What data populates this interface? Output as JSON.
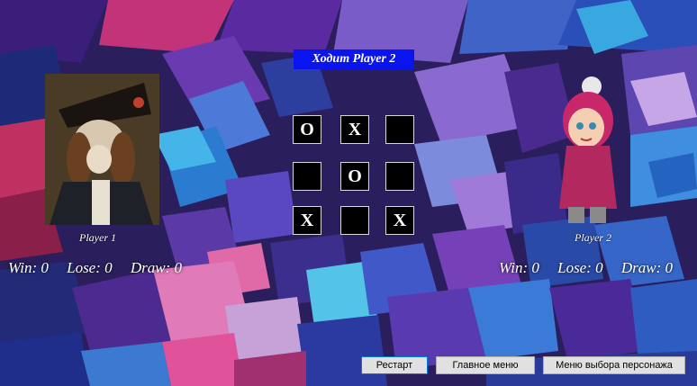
{
  "turn_banner": "Ходит Player 2",
  "player1": {
    "label": "Player 1",
    "win": "Win: 0",
    "lose": "Lose: 0",
    "draw": "Draw: 0"
  },
  "player2": {
    "label": "Player 2",
    "win": "Win: 0",
    "lose": "Lose: 0",
    "draw": "Draw: 0"
  },
  "board": [
    "O",
    "X",
    "",
    "",
    "O",
    "",
    "X",
    "",
    "X"
  ],
  "buttons": {
    "restart": "Рестарт",
    "main_menu": "Главное меню",
    "character_select": "Меню выбора персонажа"
  },
  "colors": {
    "banner": "#0a14ee",
    "cell": "#000000",
    "text": "#ffffff"
  }
}
